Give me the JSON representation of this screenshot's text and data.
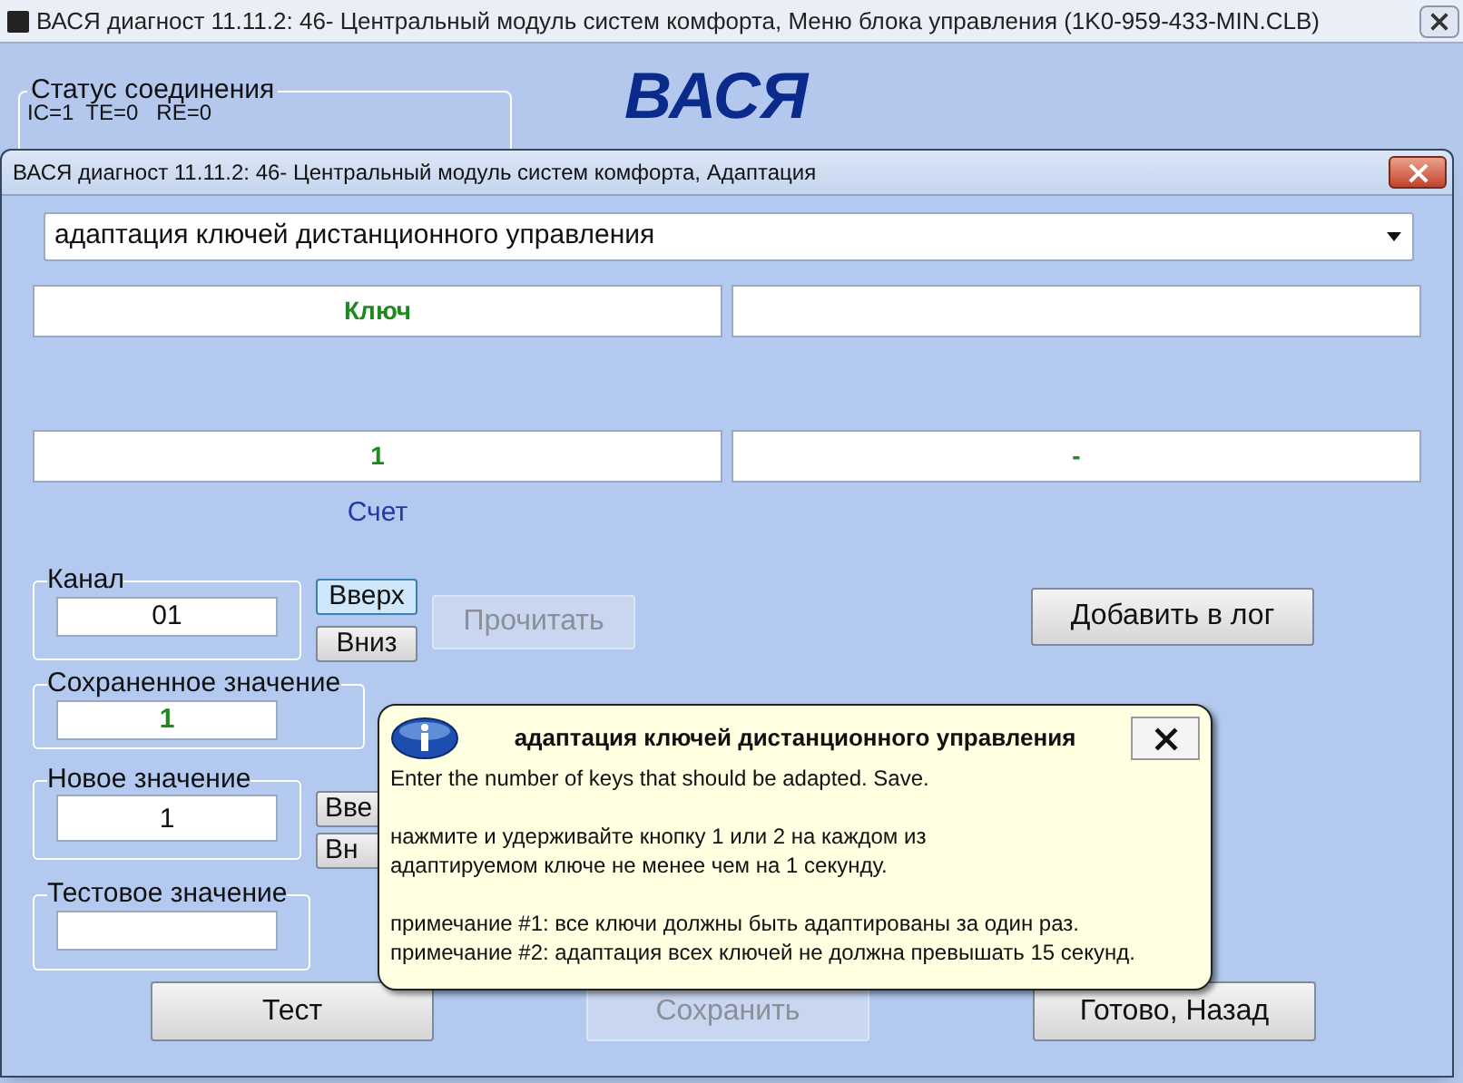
{
  "background_window": {
    "title": "ВАСЯ диагност 11.11.2: 46- Центральный модуль систем комфорта,  Меню блока управления (1K0-959-433-MIN.CLB)",
    "logo": "ВАСЯ",
    "status_group": {
      "label": "Статус соединения",
      "values": "IC=1  TE=0   RE=0"
    }
  },
  "dialog": {
    "title": "ВАСЯ диагност 11.11.2: 46- Центральный модуль систем комфорта, Адаптация",
    "function_select": {
      "value": "адаптация ключей дистанционного управления"
    },
    "row_1": {
      "column_1": "Ключ"
    },
    "row_2": {
      "column_1": "1",
      "column_2": "-"
    },
    "row_2_caption": "Счет",
    "channel": {
      "label": "Канал",
      "value": "01",
      "up": {
        "label": "Вверх",
        "highlighted": true
      },
      "down": {
        "label": "Вниз",
        "highlighted": false
      }
    },
    "read_button": {
      "label": "Прочитать",
      "disabled": true
    },
    "log_button": {
      "label": "Добавить в лог",
      "disabled": false
    },
    "saved_value": {
      "label": "Сохраненное значение",
      "value": "1"
    },
    "new_value": {
      "label": "Новое значение",
      "value": "1",
      "up": {
        "label": "Вве",
        "highlighted": false
      },
      "down": {
        "label": "Вн",
        "highlighted": false
      }
    },
    "test_value": {
      "label": "Тестовое значение"
    },
    "bottom_buttons": [
      {
        "label": "Тест",
        "disabled": false
      },
      {
        "label": "Сохранить",
        "disabled": true
      },
      {
        "label": "Готово, Назад",
        "disabled": false
      }
    ],
    "popup": {
      "title": "адаптация ключей дистанционного управления",
      "paragraphs": [
        "Enter the number of keys that should be adapted. Save.",
        "нажмите и удерживайте кнопку 1 или 2 на каждом из\nадаптируемом ключе не менее чем на 1 секунду.",
        "примечание #1: все ключи должны быть адаптированы за один раз.\nпримечание #2: адаптация всех ключей не должна превышать 15 секунд."
      ]
    }
  }
}
